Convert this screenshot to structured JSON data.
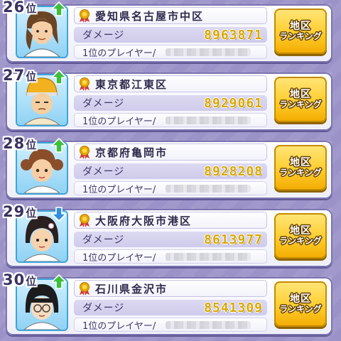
{
  "rank_suffix": "位",
  "damage_label": "ダメージ",
  "player_label": "1位のプレイヤー/",
  "button": {
    "line1": "地区",
    "line2": "ランキング"
  },
  "colors": {
    "trend_up": "#3cbf3c",
    "trend_down": "#2f8fe0",
    "damage_value": "#d9a800",
    "button": "#ffcd2e"
  },
  "entries": [
    {
      "rank": "26",
      "trend": "up",
      "region": "愛知県名古屋市中区",
      "damage": "8963871"
    },
    {
      "rank": "27",
      "trend": "up",
      "region": "東京都江東区",
      "damage": "8929061"
    },
    {
      "rank": "28",
      "trend": "up",
      "region": "京都府亀岡市",
      "damage": "8928208"
    },
    {
      "rank": "29",
      "trend": "down",
      "region": "大阪府大阪市港区",
      "damage": "8613977"
    },
    {
      "rank": "30",
      "trend": "up",
      "region": "石川県金沢市",
      "damage": "8541309"
    }
  ]
}
